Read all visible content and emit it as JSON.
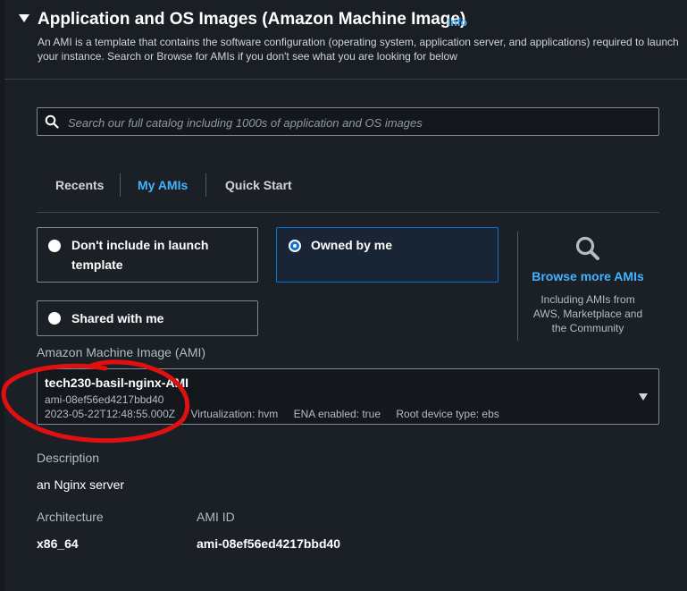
{
  "section": {
    "title": "Application and OS Images (Amazon Machine Image)",
    "info_link": "Info",
    "description": "An AMI is a template that contains the software configuration (operating system, application server, and applications) required to launch your instance. Search or Browse for AMIs if you don't see what you are looking for below"
  },
  "search": {
    "placeholder": "Search our full catalog including 1000s of application and OS images",
    "value": ""
  },
  "tabs": [
    {
      "label": "Recents",
      "active": false
    },
    {
      "label": "My AMIs",
      "active": true
    },
    {
      "label": "Quick Start",
      "active": false
    }
  ],
  "ownership_options": [
    {
      "label": "Don't include in launch template",
      "selected": false
    },
    {
      "label": "Owned by me",
      "selected": true
    },
    {
      "label": "Shared with me",
      "selected": false
    }
  ],
  "browse": {
    "icon": "search-icon",
    "link": "Browse more AMIs",
    "subtext": "Including AMIs from AWS, Marketplace and the Community"
  },
  "ami": {
    "label": "Amazon Machine Image (AMI)",
    "name": "tech230-basil-nginx-AMI",
    "id": "ami-08ef56ed4217bbd40",
    "date": "2023-05-22T12:48:55.000Z",
    "virtualization": "Virtualization: hvm",
    "ena": "ENA enabled: true",
    "root_device": "Root device type: ebs"
  },
  "details": {
    "description_label": "Description",
    "description_value": "an Nginx server",
    "architecture_label": "Architecture",
    "architecture_value": "x86_64",
    "ami_id_label": "AMI ID",
    "ami_id_value": "ami-08ef56ed4217bbd40"
  },
  "colors": {
    "accent": "#42b4ff",
    "selected_border": "#0972d3",
    "annotation": "#e01010"
  }
}
